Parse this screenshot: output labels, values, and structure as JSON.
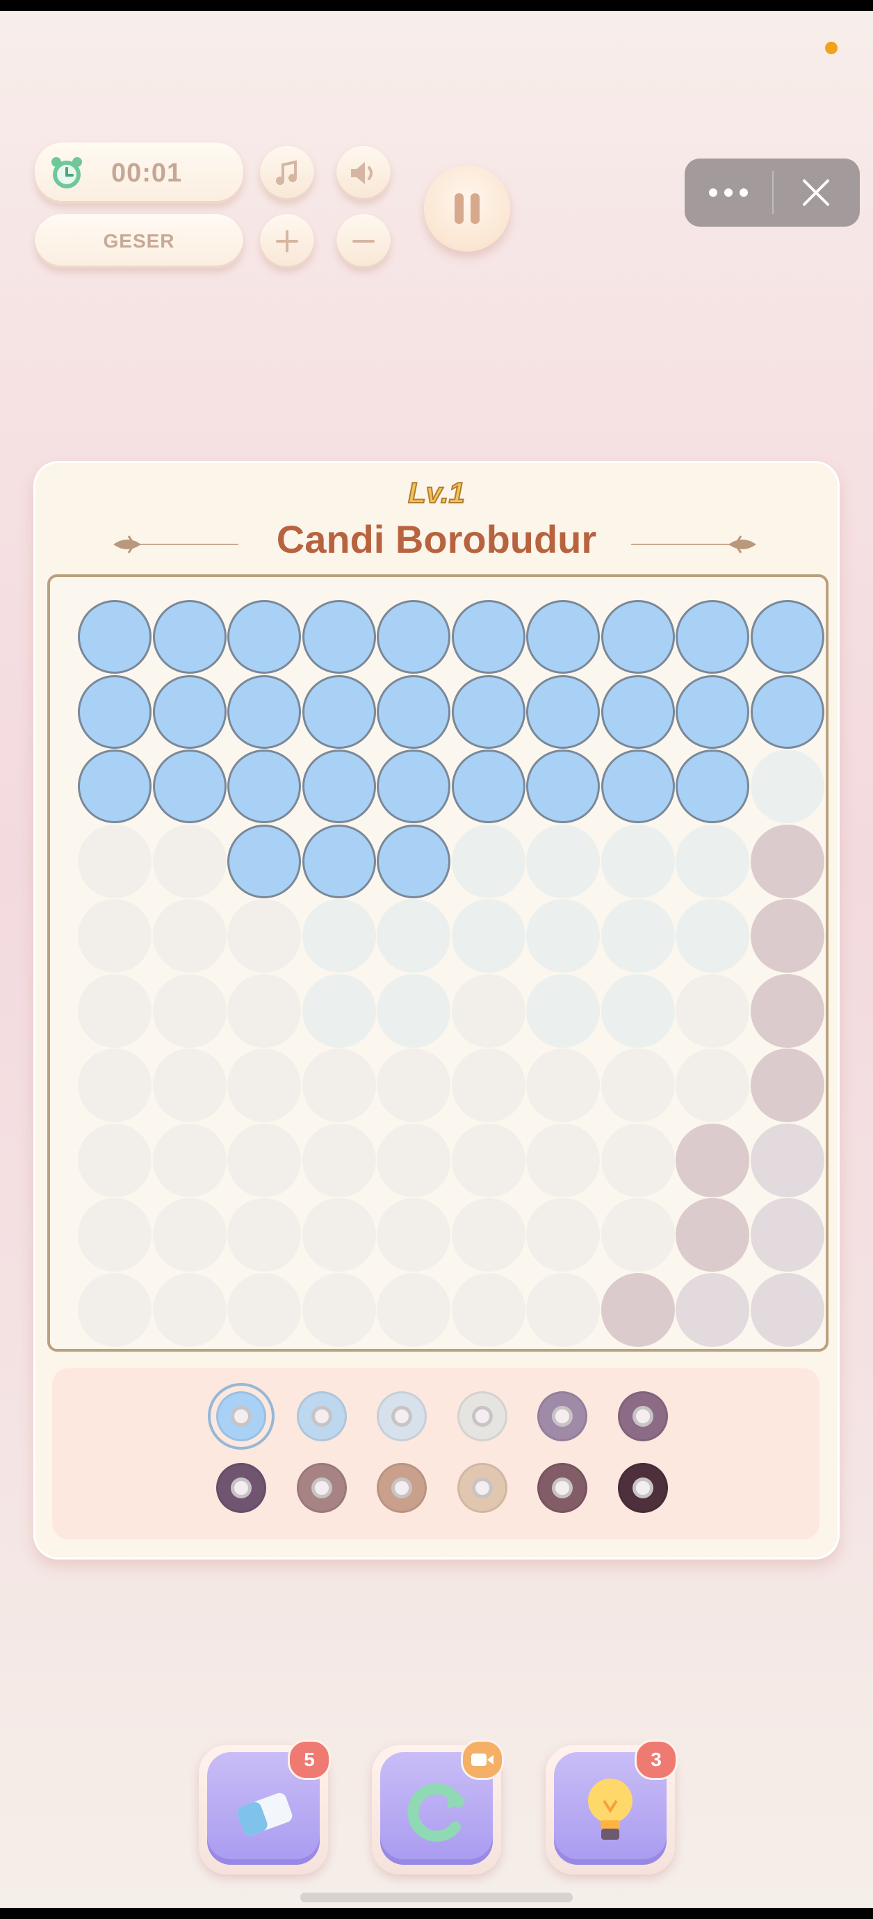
{
  "status": {
    "indicator_color": "#f0a21a"
  },
  "hud": {
    "timer": "00:01",
    "geser_label": "GESER",
    "buttons": [
      "music-note-icon",
      "speaker-icon",
      "plus-icon",
      "minus-icon",
      "pause-icon"
    ]
  },
  "capsule": {
    "more_icon": "more-dots-icon",
    "close_icon": "close-icon"
  },
  "level": {
    "badge": "Lv.1",
    "title": "Candi Borobudur"
  },
  "board": {
    "size": 10,
    "legend": {
      "B": "#a8d1f5",
      "E": "#f2efea",
      "I": "#ebf0ee",
      "M": "#dccbcc",
      "L": "#e2dadc"
    },
    "rows": [
      "BBBBBBBBBB",
      "BBBBBBBBBB",
      "BBBBBBBBBI",
      "EEBBBIIIIM",
      "EEEIIIIIIM",
      "EEEIIEIIEM",
      "EEEEEEEEEM",
      "EEEEEEEEML",
      "EEEEEEEEML",
      "EEEEEEEMLL"
    ]
  },
  "palette": {
    "selected_index": 0,
    "colors": [
      "#a8d1f5",
      "#bcd7ee",
      "#d6e1eb",
      "#e6e4e1",
      "#9f8aa8",
      "#8c6b86",
      "#6f5570",
      "#a88384",
      "#c9a08c",
      "#e2c7b0",
      "#825c66",
      "#4e2f3c"
    ]
  },
  "powerups": [
    {
      "name": "eraser",
      "icon": "eraser-icon",
      "badge": "5"
    },
    {
      "name": "refresh",
      "icon": "refresh-icon",
      "badge": "video-icon"
    },
    {
      "name": "hint",
      "icon": "lightbulb-icon",
      "badge": "3"
    }
  ]
}
